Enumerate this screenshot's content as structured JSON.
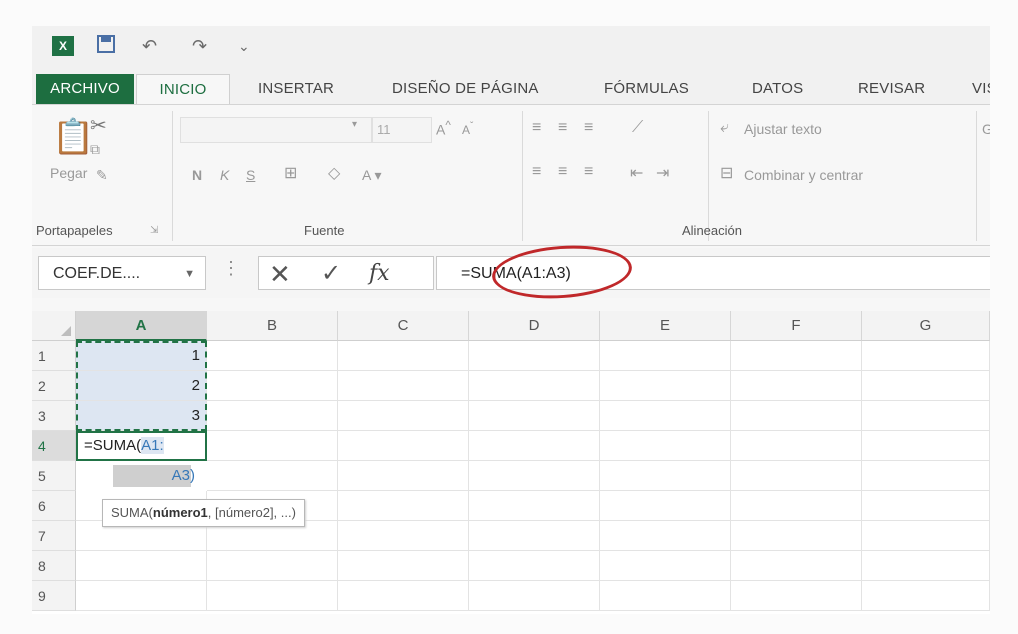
{
  "quick_access": {
    "app_icon": "excel-icon",
    "items": [
      "save-icon",
      "undo-icon",
      "redo-icon",
      "customize-icon"
    ]
  },
  "tabs": [
    "ARCHIVO",
    "INICIO",
    "INSERTAR",
    "DISEÑO DE PÁGINA",
    "FÓRMULAS",
    "DATOS",
    "REVISAR",
    "VIS"
  ],
  "ribbon": {
    "paste_label": "Pegar",
    "font_size": "11",
    "bold": "N",
    "italic": "K",
    "underline": "S",
    "wrap_text": "Ajustar texto",
    "merge_center": "Combinar y centrar",
    "number_format": "Ge",
    "groups": [
      "Portapapeles",
      "Fuente",
      "Alineación"
    ]
  },
  "formula_bar": {
    "name_box": "COEF.DE....",
    "cancel": "✕",
    "enter": "✓",
    "fx": "fx",
    "formula": "=SUMA(A1:A3)"
  },
  "sheet": {
    "columns": [
      "A",
      "B",
      "C",
      "D",
      "E",
      "F",
      "G"
    ],
    "rows": [
      "1",
      "2",
      "3",
      "4",
      "5",
      "6",
      "7",
      "8",
      "9"
    ],
    "values": {
      "A1": "1",
      "A2": "2",
      "A3": "3"
    },
    "edit_cell_prefix": "=SUMA(",
    "edit_cell_ref": "A1:",
    "edit_cell_cont": "A3)",
    "tooltip_fn": "SUMA(",
    "tooltip_arg1": "número1",
    "tooltip_rest": ", [número2], ...)"
  },
  "annotation": {
    "color": "#c0282a"
  }
}
